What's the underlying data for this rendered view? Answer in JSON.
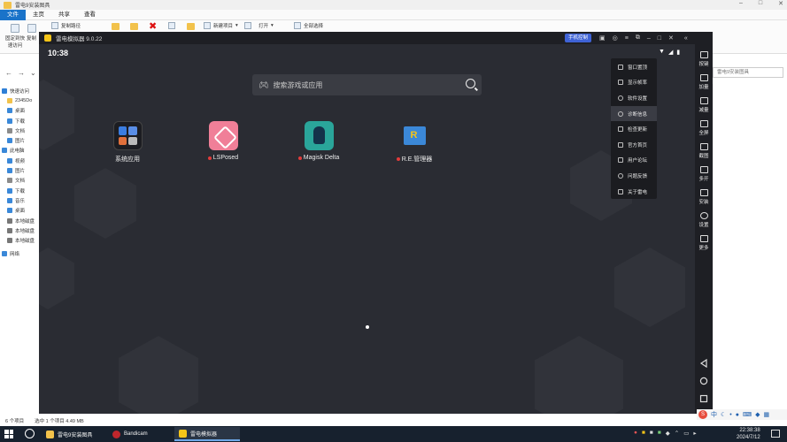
{
  "explorer": {
    "window_title": "雷电9安装图具",
    "ribbon_tabs": [
      "文件",
      "主页",
      "共享",
      "查看"
    ],
    "ribbon": {
      "pin_label": "固定到快\n速访问",
      "copy_label": "复制",
      "copy_path": "复制路径",
      "new_item": "新建项目",
      "open": "打开",
      "select_all": "全部选择"
    },
    "search_placeholder": "雷电9安装图具",
    "nav": [
      {
        "label": "快速访问",
        "color": "#2f7fd6"
      },
      {
        "label": "2345Do",
        "color": "#f2c24b"
      },
      {
        "label": "桌面",
        "color": "#3a88d8"
      },
      {
        "label": "下载",
        "color": "#3a88d8"
      },
      {
        "label": "文档",
        "color": "#8b8b8b"
      },
      {
        "label": "图片",
        "color": "#3a88d8"
      },
      {
        "label": "此电脑",
        "color": "#3a88d8"
      },
      {
        "label": "视频",
        "color": "#3a88d8"
      },
      {
        "label": "图片",
        "color": "#3a88d8"
      },
      {
        "label": "文档",
        "color": "#8b8b8b"
      },
      {
        "label": "下载",
        "color": "#3a88d8"
      },
      {
        "label": "音乐",
        "color": "#3a88d8"
      },
      {
        "label": "桌面",
        "color": "#3a88d8"
      },
      {
        "label": "本地磁盘",
        "color": "#777777"
      },
      {
        "label": "本地磁盘",
        "color": "#777777"
      },
      {
        "label": "本地磁盘",
        "color": "#777777"
      },
      {
        "label": "网络",
        "color": "#3a88d8"
      }
    ],
    "status": {
      "items": "6 个项目",
      "selected": "选中 1 个项目  4.49 MB"
    }
  },
  "emulator": {
    "title": "雷电模拟器 9.0.22",
    "phone_control": "手机控制",
    "clock": "10:38",
    "search_placeholder": "搜索游戏或应用",
    "apps": [
      {
        "label": "系统应用",
        "new_dot": false
      },
      {
        "label": "LSPosed",
        "new_dot": true
      },
      {
        "label": "Magisk Delta",
        "new_dot": true
      },
      {
        "label": "R.E.管理器",
        "new_dot": true
      }
    ],
    "menu": [
      "窗口置顶",
      "显示帧率",
      "软件设置",
      "诊断信息",
      "检查更新",
      "官方首页",
      "用户论坛",
      "问题反馈",
      "关于雷电"
    ],
    "sidebar": [
      "按键",
      "加量",
      "减量",
      "全屏",
      "截图",
      "多开",
      "安装",
      "设置",
      "更多"
    ]
  },
  "taskbar": {
    "tasks": [
      "雷电9安装图具",
      "Bandicam",
      "雷电模拟器"
    ],
    "time": "22:38:38",
    "date": "2024/7/12",
    "ime": "中"
  }
}
